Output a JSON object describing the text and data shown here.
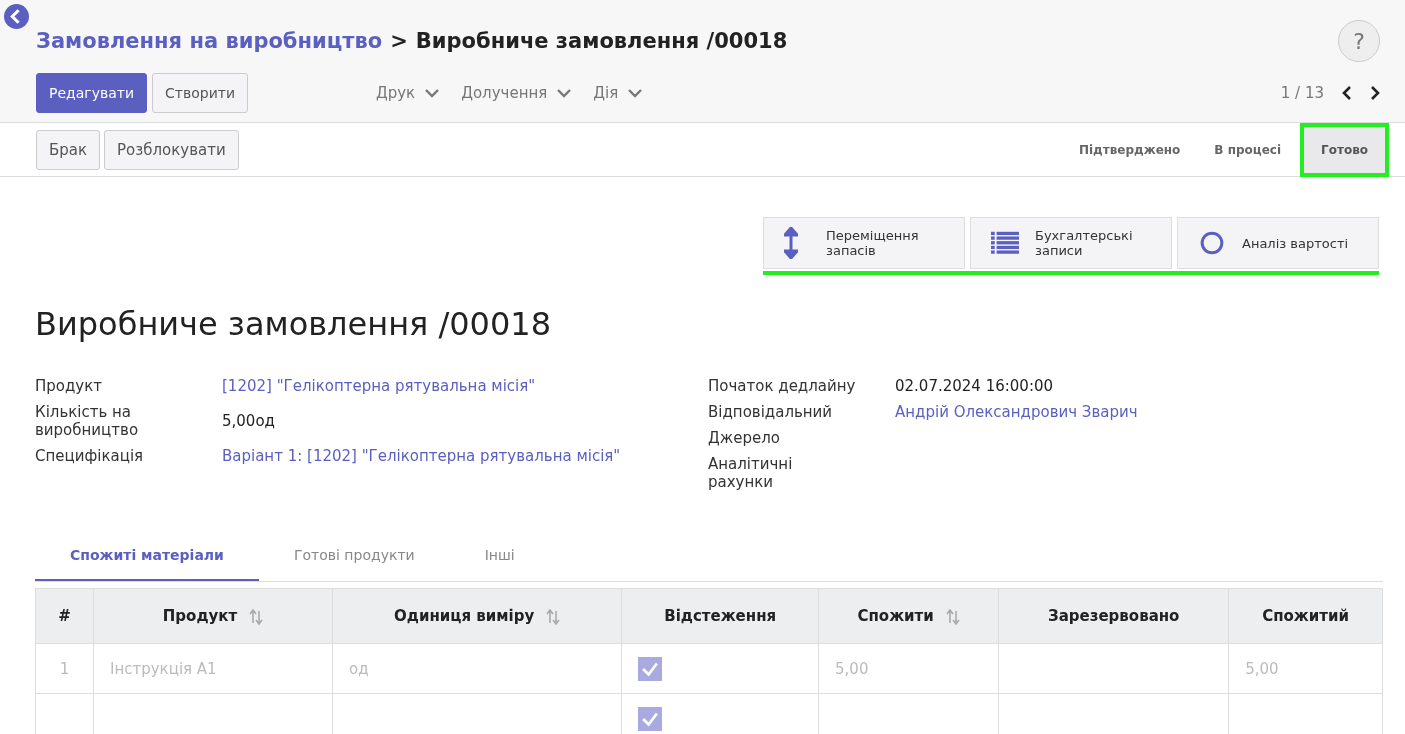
{
  "breadcrumb": {
    "parent": "Замовлення на виробництво",
    "separator": ">",
    "current": "Виробниче замовлення /00018"
  },
  "help_button": "?",
  "main_buttons": [
    {
      "label": "Редагувати",
      "primary": true
    },
    {
      "label": "Створити",
      "primary": false
    }
  ],
  "menus": [
    "Друк",
    "Долучення",
    "Дія"
  ],
  "pager": {
    "text": "1 / 13"
  },
  "action_buttons": [
    "Брак",
    "Розблокувати"
  ],
  "statuses": [
    {
      "label": "Підтверджено",
      "selected": false,
      "highlighted": false
    },
    {
      "label": "В процесі",
      "selected": false,
      "highlighted": false
    },
    {
      "label": "Готово",
      "selected": true,
      "highlighted": true
    }
  ],
  "smart_buttons_highlighted": true,
  "smart_buttons": [
    {
      "kind": "moves",
      "label": "Переміщення запасів"
    },
    {
      "kind": "list",
      "label": "Бухгалтерські записи"
    },
    {
      "kind": "circle",
      "label": "Аналіз вартості"
    }
  ],
  "title": "Виробниче замовлення /00018",
  "fields_left": [
    {
      "label": "Продукт",
      "value": "[1202] \"Гелікоптерна рятувальна місія\"",
      "link": true
    },
    {
      "label": "Кількість на виробництво",
      "value": "5,00од",
      "link": false
    },
    {
      "label": "Специфікація",
      "value": "Варіант 1: [1202] \"Гелікоптерна рятувальна місія\"",
      "link": true
    }
  ],
  "fields_right": [
    {
      "label": "Початок дедлайну",
      "value": "02.07.2024 16:00:00",
      "link": false
    },
    {
      "label": "Відповідальний",
      "value": "Андрій Олександрович Зварич",
      "link": true
    },
    {
      "label": "Джерело"
    },
    {
      "label": "Аналітичні рахунки"
    }
  ],
  "tabs": [
    {
      "label": "Спожиті матеріали",
      "selected": true
    },
    {
      "label": "Готові продукти",
      "selected": false
    },
    {
      "label": "Інші",
      "selected": false
    }
  ],
  "table": {
    "columns": [
      {
        "label": "#",
        "sortable": false
      },
      {
        "label": "Продукт",
        "sortable": true
      },
      {
        "label": "Одиниця виміру",
        "sortable": true
      },
      {
        "label": "Відстеження",
        "sortable": false
      },
      {
        "label": "Спожити",
        "sortable": true
      },
      {
        "label": "Зарезервовано",
        "sortable": false
      },
      {
        "label": "Спожитий",
        "sortable": false
      }
    ],
    "rows": [
      {
        "num": "1",
        "product": "Інструкція А1",
        "uom": "од",
        "tracked": true,
        "to_consume": "5,00",
        "consumed": "5,00"
      },
      {
        "tracked": true
      }
    ]
  }
}
